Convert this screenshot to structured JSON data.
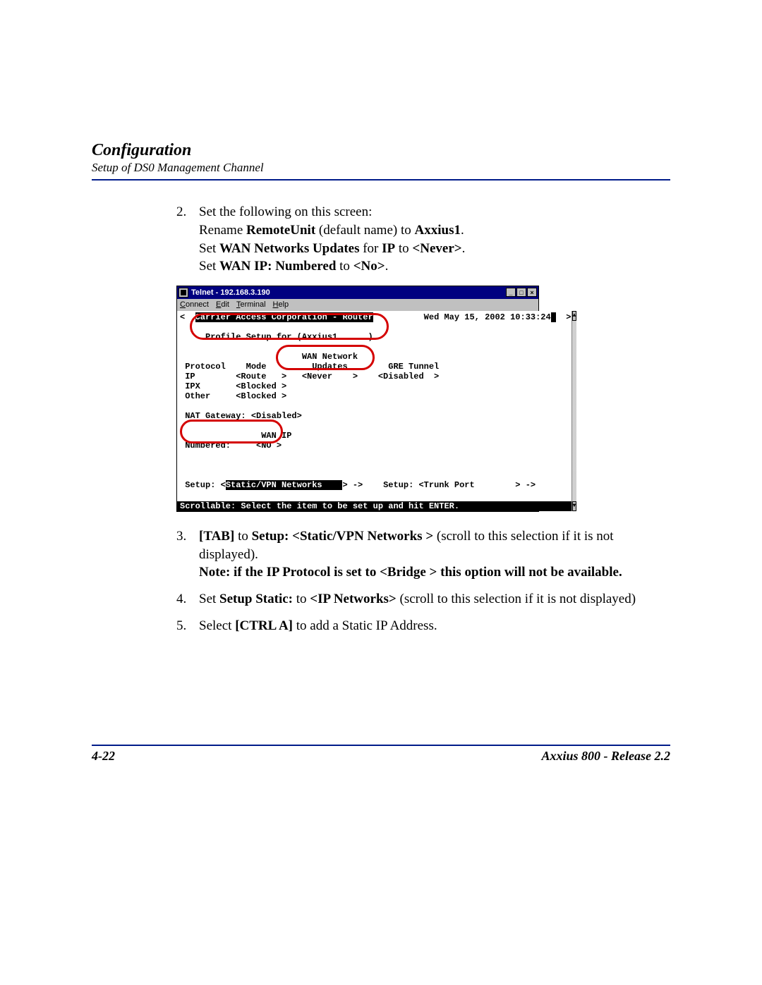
{
  "header": {
    "title": "Configuration",
    "subtitle": "Setup of DS0 Management Channel"
  },
  "steps": {
    "s2": {
      "index": "2.",
      "line1": "Set the following on this screen:",
      "line2a": "Rename ",
      "line2b": "RemoteUnit",
      "line2c": " (default name) to ",
      "line2d": "Axxius1",
      "line2e": ".",
      "line3a": "Set ",
      "line3b": "WAN Networks Updates",
      "line3c": " for ",
      "line3d": "IP",
      "line3e": " to ",
      "line3f": "<Never>",
      "line3g": ".",
      "line4a": "Set ",
      "line4b": "WAN IP: Numbered",
      "line4c": " to ",
      "line4d": "<No>",
      "line4e": "."
    },
    "s3": {
      "index": "3.",
      "key": "[TAB]",
      "t1": " to ",
      "bold": "Setup: <Static/VPN Networks >",
      "t2": " (scroll to this selection if it is not displayed).",
      "noteBold": "Note: if the IP Protocol is set to <Bridge > this option will not be available."
    },
    "s4": {
      "index": "4.",
      "t1": "Set ",
      "b1": "Setup Static:",
      "t2": " to ",
      "b2": "<IP Networks>",
      "t3": " (scroll to this selection if it is not displayed)"
    },
    "s5": {
      "index": "5.",
      "t1": "Select ",
      "b1": "[CTRL A]",
      "t2": " to add a Static IP Address."
    }
  },
  "telnet": {
    "title": "Telnet - 192.168.3.190",
    "menu": {
      "connect": "Connect",
      "edit": "Edit",
      "terminal": "Terminal",
      "help": "Help"
    },
    "winbtns": {
      "min": "_",
      "max": "□",
      "close": "×"
    },
    "sb": {
      "up": "▲",
      "down": "▼"
    },
    "lines": {
      "l0a": "<  ",
      "l0b": "Carrier Access Corporation - Router",
      "l0c": "          Wed May 15, 2002 10:33:24",
      "l0d": "  >",
      "l1": "",
      "l2": "     Profile Setup for (Axxius1      )",
      "l3": "",
      "l4": "                        WAN Network",
      "l5": " Protocol    Mode         Updates        GRE Tunnel",
      "l6": " IP        <Route   >   <Never    >    <Disabled  >",
      "l7": " IPX       <Blocked >",
      "l8": " Other     <Blocked >",
      "l9": "",
      "l10": " NAT Gateway: <Disabled>",
      "l11": "",
      "l12": "                WAN IP",
      "l13": " Numbered:     <NO >",
      "l14": "",
      "l18a": " Setup: <",
      "l18b": "Static/VPN Networks    ",
      "l18c": "> ->    Setup: <Trunk Port        > ->",
      "status": "Scrollable: Select the item to be set up and hit ENTER."
    }
  },
  "footer": {
    "page": "4-22",
    "product": "Axxius 800 - Release 2.2"
  }
}
